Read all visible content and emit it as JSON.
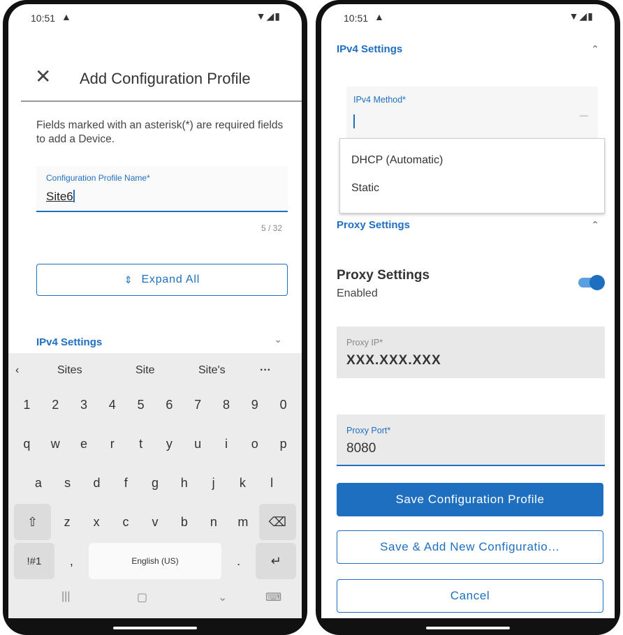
{
  "left": {
    "status": {
      "time": "10:51",
      "warn_icon": "warning-icon",
      "system_icons": "wifi-icon signal-icon battery-icon"
    },
    "header": {
      "close_icon": "close-icon",
      "title": "Add Configuration Profile"
    },
    "help_text": "Fields marked with an asterisk(*) are required fields to add a Device.",
    "name_field": {
      "label": "Configuration Profile Name*",
      "value": "Site6",
      "counter": "5 / 32"
    },
    "expand_all": {
      "label": "Expand All",
      "icon": "expand-icon"
    },
    "ipv4_section": {
      "label": "IPv4 Settings",
      "chevron": "chevron-down-icon"
    },
    "keyboard": {
      "suggestions": [
        "Sites",
        "Site",
        "Site's"
      ],
      "back_icon": "chevron-left-icon",
      "more_icon": "more-icon",
      "row_numbers": [
        "1",
        "2",
        "3",
        "4",
        "5",
        "6",
        "7",
        "8",
        "9",
        "0"
      ],
      "row_q": [
        "q",
        "w",
        "e",
        "r",
        "t",
        "y",
        "u",
        "i",
        "o",
        "p"
      ],
      "row_a": [
        "a",
        "s",
        "d",
        "f",
        "g",
        "h",
        "j",
        "k",
        "l"
      ],
      "row_z": [
        "z",
        "x",
        "c",
        "v",
        "b",
        "n",
        "m"
      ],
      "symbols_key": "!#1",
      "comma_key": ",",
      "space_label": "English (US)",
      "period_key": ".",
      "shift_glyph": "⇧",
      "backspace_glyph": "⌫",
      "enter_glyph": "↵",
      "nav": {
        "recents": "|||",
        "home": "▢",
        "back": "⌄",
        "keyboard_icon": "⌨"
      }
    }
  },
  "right": {
    "status": {
      "time": "10:51"
    },
    "ipv4_section": {
      "label": "IPv4 Settings",
      "chevron": "chevron-up-icon"
    },
    "method_field": {
      "label": "IPv4 Method*",
      "value": ""
    },
    "dropdown_options": [
      "DHCP (Automatic)",
      "Static"
    ],
    "proxy_section": {
      "label": "Proxy Settings",
      "chevron": "chevron-up-icon"
    },
    "proxy_toggle": {
      "title": "Proxy Settings",
      "state": "Enabled",
      "on": true,
      "color": "#1f6fc0"
    },
    "proxy_ip": {
      "label": "Proxy IP*",
      "value": "XXX.XXX.XXX"
    },
    "proxy_port": {
      "label": "Proxy Port*",
      "value": "8080"
    },
    "buttons": {
      "save": "Save Configuration Profile",
      "save_add": "Save & Add New Configuratio…",
      "cancel": "Cancel"
    }
  },
  "colors": {
    "accent": "#1f6fc0",
    "field_bg": "#e8e8e8"
  }
}
